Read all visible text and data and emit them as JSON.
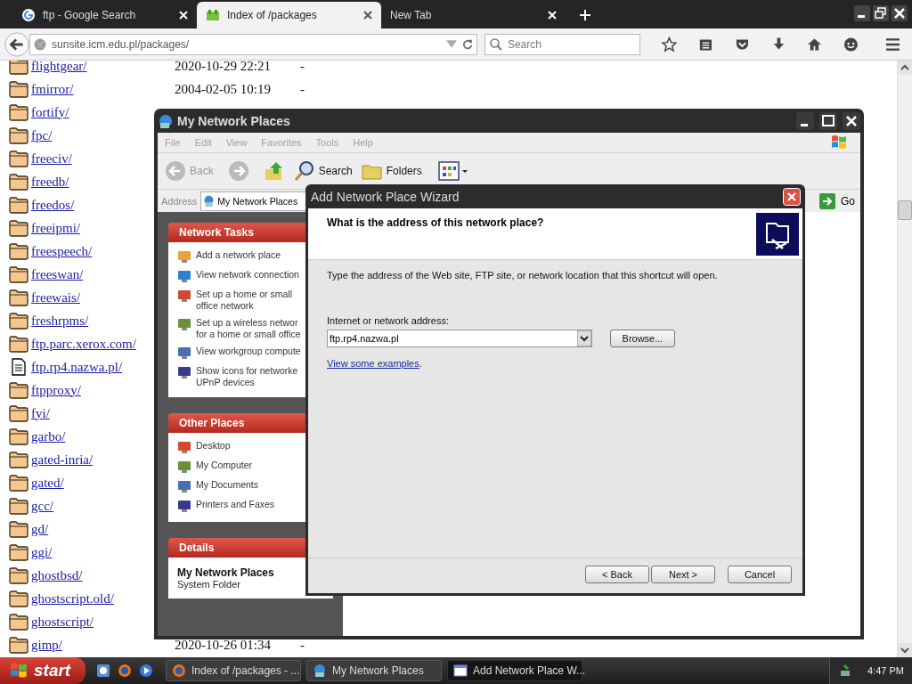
{
  "browser": {
    "tabs": [
      {
        "title": "ftp - Google Search",
        "kind": "search",
        "selected": false
      },
      {
        "title": "Index of /packages",
        "kind": "page",
        "selected": true
      },
      {
        "title": "New Tab",
        "kind": "blank",
        "selected": false
      }
    ],
    "url": "sunsite.icm.edu.pl/packages/",
    "search": {
      "placeholder": "Search"
    }
  },
  "listing": [
    {
      "name": "flightgear/",
      "kind": "folder",
      "date": "2020-10-29 22:21",
      "size": "-"
    },
    {
      "name": "fmirror/",
      "kind": "folder",
      "date": "2004-02-05 10:19",
      "size": "-"
    },
    {
      "name": "fortify/",
      "kind": "folder"
    },
    {
      "name": "fpc/",
      "kind": "folder"
    },
    {
      "name": "freeciv/",
      "kind": "folder"
    },
    {
      "name": "freedb/",
      "kind": "folder"
    },
    {
      "name": "freedos/",
      "kind": "folder"
    },
    {
      "name": "freeipmi/",
      "kind": "folder"
    },
    {
      "name": "freespeech/",
      "kind": "folder"
    },
    {
      "name": "freeswan/",
      "kind": "folder"
    },
    {
      "name": "freewais/",
      "kind": "folder"
    },
    {
      "name": "freshrpms/",
      "kind": "folder"
    },
    {
      "name": "ftp.parc.xerox.com/",
      "kind": "folder"
    },
    {
      "name": "ftp.rp4.nazwa.pl/",
      "kind": "file"
    },
    {
      "name": "ftpproxy/",
      "kind": "folder"
    },
    {
      "name": "fyi/",
      "kind": "folder"
    },
    {
      "name": "garbo/",
      "kind": "folder"
    },
    {
      "name": "gated-inria/",
      "kind": "folder"
    },
    {
      "name": "gated/",
      "kind": "folder"
    },
    {
      "name": "gcc/",
      "kind": "folder"
    },
    {
      "name": "gd/",
      "kind": "folder"
    },
    {
      "name": "ggi/",
      "kind": "folder"
    },
    {
      "name": "ghostbsd/",
      "kind": "folder"
    },
    {
      "name": "ghostscript.old/",
      "kind": "folder"
    },
    {
      "name": "ghostscript/",
      "kind": "folder"
    },
    {
      "name": "gimp/",
      "kind": "folder",
      "date": "2020-10-26 01:34",
      "size": "-"
    }
  ],
  "explorer": {
    "title": "My Network Places",
    "menu": [
      "File",
      "Edit",
      "View",
      "Favorites",
      "Tools",
      "Help"
    ],
    "toolbar": {
      "back": "Back",
      "search": "Search",
      "folders": "Folders"
    },
    "address": {
      "label": "Address",
      "value": "My Network Places",
      "go": "Go"
    },
    "panes": [
      {
        "title": "Network Tasks",
        "kind": "tasks",
        "items": [
          {
            "lines": [
              "Add a network place"
            ]
          },
          {
            "lines": [
              "View network connection"
            ]
          },
          {
            "lines": [
              "Set up a home or small",
              "office network"
            ]
          },
          {
            "lines": [
              "Set up a wireless networ",
              "for a home or small office"
            ]
          },
          {
            "lines": [
              "View workgroup compute"
            ]
          },
          {
            "lines": [
              "Show icons for networke",
              "UPnP devices"
            ]
          }
        ]
      },
      {
        "title": "Other Places",
        "kind": "tasks",
        "items": [
          {
            "lines": [
              "Desktop"
            ]
          },
          {
            "lines": [
              "My Computer"
            ]
          },
          {
            "lines": [
              "My Documents"
            ]
          },
          {
            "lines": [
              "Printers and Faxes"
            ]
          }
        ]
      },
      {
        "title": "Details",
        "kind": "details",
        "name": "My Network Places",
        "type": "System Folder"
      }
    ]
  },
  "wizard": {
    "title": "Add Network Place Wizard",
    "heading": "What is the address of this network place?",
    "instruction": "Type the address of the Web site, FTP site, or network location that this shortcut will open.",
    "field_label": "Internet or network address:",
    "address_value": "ftp.rp4.nazwa.pl",
    "browse": "Browse...",
    "link": "View some examples",
    "link_trail": ".",
    "buttons": [
      "< Back",
      "Next >",
      "Cancel"
    ]
  },
  "taskbar": {
    "start": "start",
    "tasks": [
      {
        "label": "Index of /packages - ...",
        "kind": "browser",
        "selected": false
      },
      {
        "label": "My Network Places",
        "kind": "network",
        "selected": false
      },
      {
        "label": "Add Network Place W...",
        "kind": "window",
        "selected": true
      }
    ],
    "clock": "4:47 PM"
  }
}
